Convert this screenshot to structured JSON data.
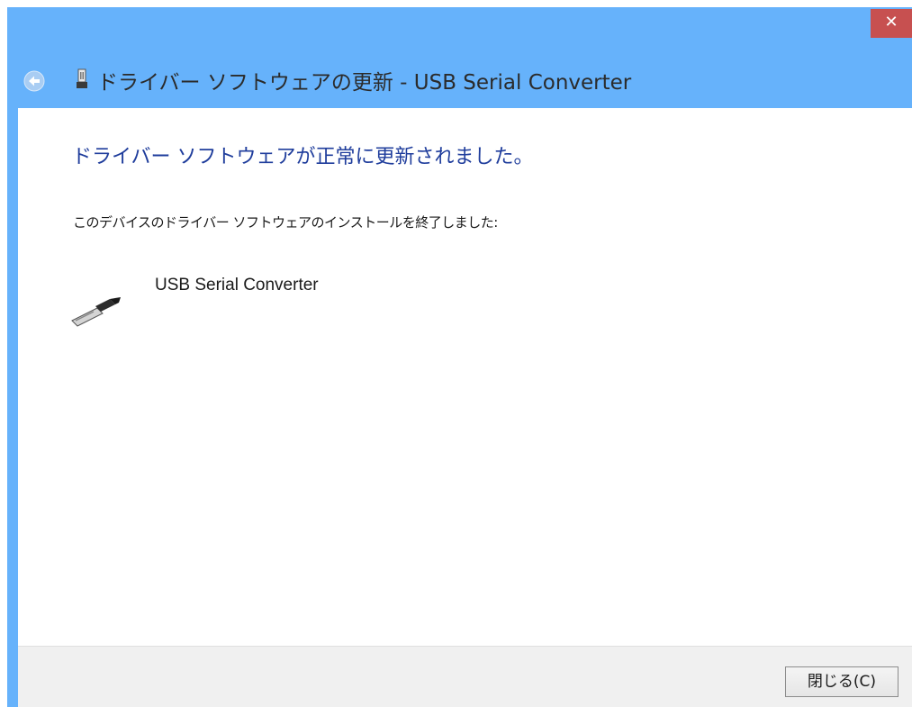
{
  "window": {
    "close_glyph": "✕",
    "title": "ドライバー ソフトウェアの更新 - USB Serial Converter",
    "back_icon": "back-arrow-icon",
    "title_icon": "usb-device-icon"
  },
  "main": {
    "heading": "ドライバー ソフトウェアが正常に更新されました。",
    "description": "このデバイスのドライバー ソフトウェアのインストールを終了しました:",
    "device": {
      "icon": "usb-connector-icon",
      "name": "USB Serial Converter"
    }
  },
  "footer": {
    "close_label": "閉じる(C)"
  },
  "colors": {
    "titlebar_bg": "#66b2fb",
    "close_btn_bg": "#c75050",
    "heading_color": "#1f3d9c",
    "footer_bg": "#f0f0f0"
  }
}
